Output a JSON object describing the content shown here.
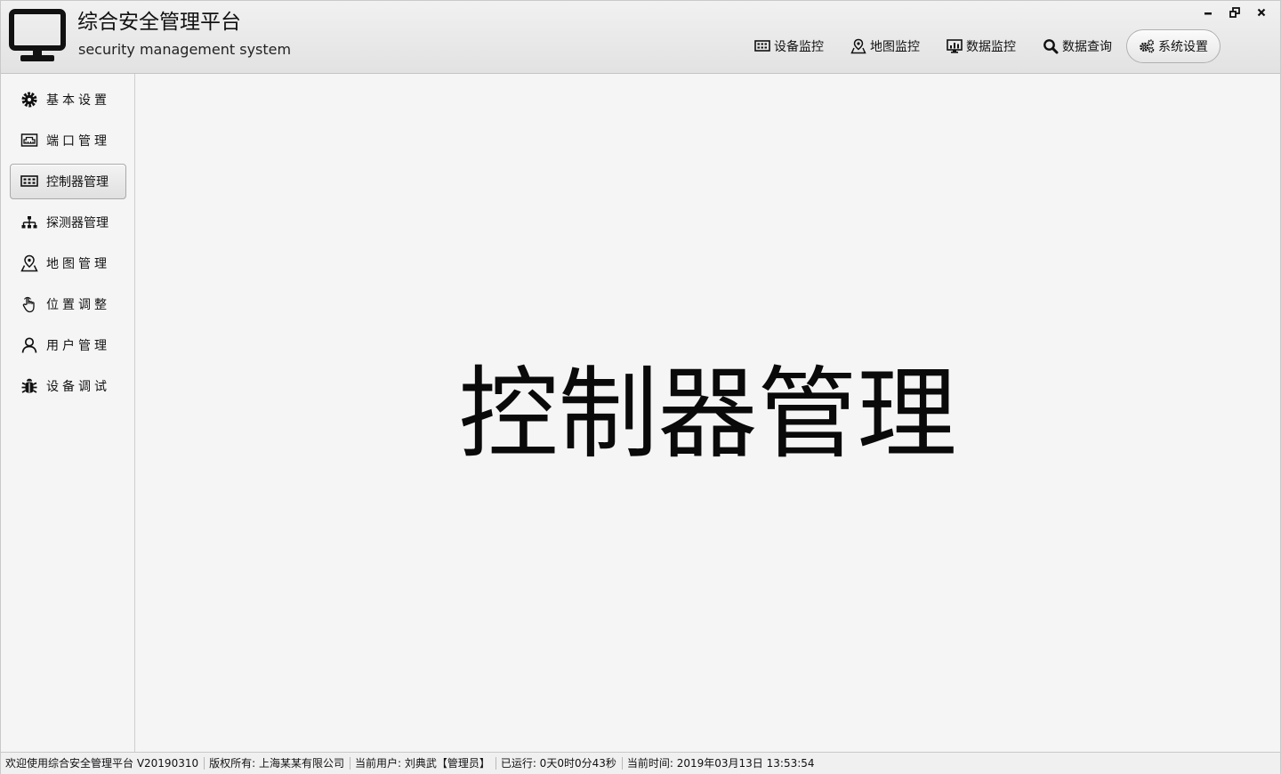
{
  "header": {
    "title": "综合安全管理平台",
    "subtitle": "security management system"
  },
  "window_controls": [
    "minimize",
    "restore",
    "close"
  ],
  "topnav": [
    {
      "label": "设备监控",
      "icon": "device-grid-icon"
    },
    {
      "label": "地图监控",
      "icon": "map-pin-icon"
    },
    {
      "label": "数据监控",
      "icon": "chart-monitor-icon"
    },
    {
      "label": "数据查询",
      "icon": "search-icon"
    },
    {
      "label": "系统设置",
      "icon": "gears-icon",
      "active": true
    }
  ],
  "sidebar": {
    "items": [
      {
        "label": "基本设置",
        "icon": "gear-icon"
      },
      {
        "label": "端口管理",
        "icon": "port-icon"
      },
      {
        "label": "控制器管理",
        "icon": "controller-icon",
        "active": true
      },
      {
        "label": "探测器管理",
        "icon": "network-tree-icon"
      },
      {
        "label": "地图管理",
        "icon": "map-pin-icon"
      },
      {
        "label": "位置调整",
        "icon": "hand-pointer-icon"
      },
      {
        "label": "用户管理",
        "icon": "user-icon"
      },
      {
        "label": "设备调试",
        "icon": "bug-icon"
      }
    ]
  },
  "main": {
    "title": "控制器管理"
  },
  "statusbar": {
    "welcome": "欢迎使用综合安全管理平台 V20190310",
    "copyright": "版权所有: 上海某某有限公司",
    "current_user": "当前用户: 刘典武【管理员】",
    "uptime": "已运行: 0天0时0分43秒",
    "current_time": "当前时间: 2019年03月13日 13:53:54"
  }
}
